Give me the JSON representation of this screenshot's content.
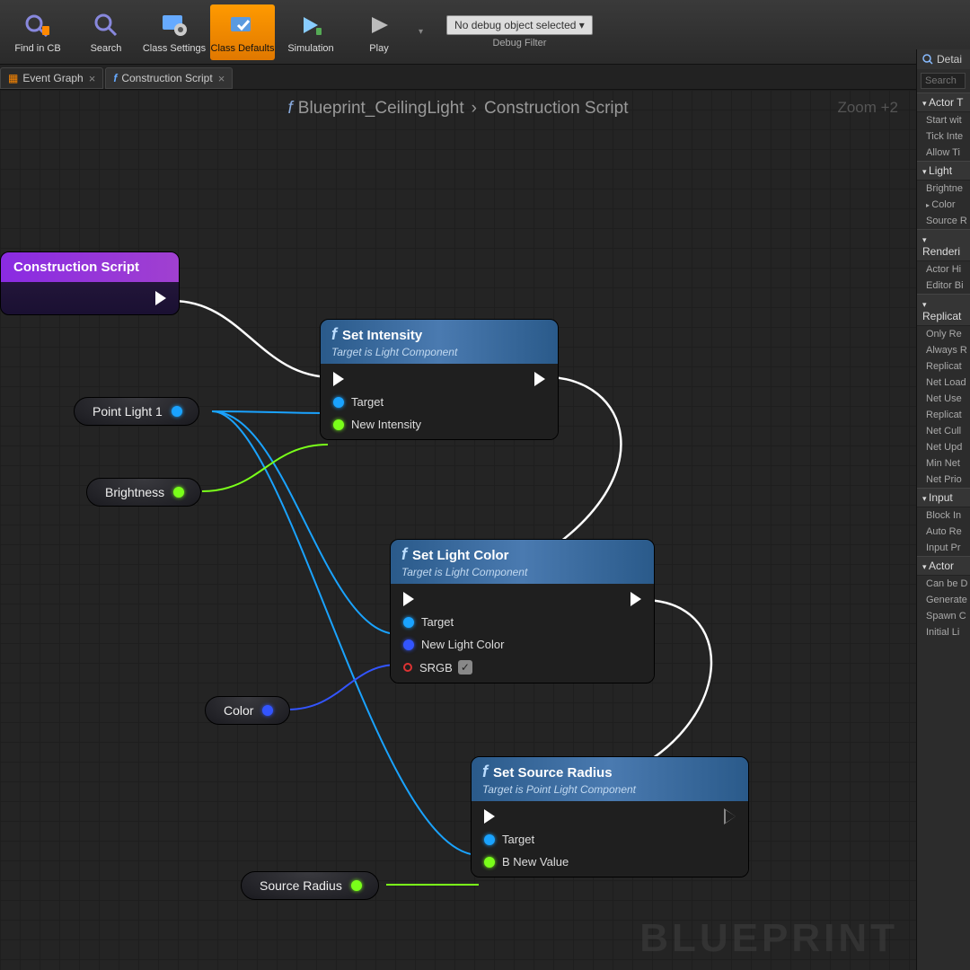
{
  "toolbar": {
    "find_cb": "Find in CB",
    "search": "Search",
    "class_settings": "Class Settings",
    "class_defaults": "Class Defaults",
    "simulation": "Simulation",
    "play": "Play",
    "debug_select": "No debug object selected ▾",
    "debug_filter": "Debug Filter"
  },
  "tabs": {
    "event_graph": "Event Graph",
    "construction_script": "Construction Script"
  },
  "breadcrumb": {
    "blueprint": "Blueprint_CeilingLight",
    "page": "Construction Script"
  },
  "zoom": "Zoom +2",
  "watermark": "BLUEPRINT",
  "nodes": {
    "entry": "Construction Script",
    "set_intensity": {
      "title": "Set Intensity",
      "sub": "Target is Light Component",
      "pin_target": "Target",
      "pin_intensity": "New Intensity"
    },
    "set_light_color": {
      "title": "Set Light Color",
      "sub": "Target is Light Component",
      "pin_target": "Target",
      "pin_color": "New Light Color",
      "pin_srgb": "SRGB"
    },
    "set_source_radius": {
      "title": "Set Source Radius",
      "sub": "Target is Point Light Component",
      "pin_target": "Target",
      "pin_value": "B New Value"
    }
  },
  "pills": {
    "point_light": "Point Light 1",
    "brightness": "Brightness",
    "color": "Color",
    "source_radius": "Source Radius"
  },
  "details": {
    "header": "Detai",
    "search_placeholder": "Search",
    "sections": {
      "actor_tick": {
        "label": "Actor T",
        "items": [
          "Start wit",
          "Tick Inte",
          "Allow Ti"
        ]
      },
      "light": {
        "label": "Light",
        "items": [
          "Brightne",
          "Color",
          "Source R"
        ]
      },
      "rendering": {
        "label": "Renderi",
        "items": [
          "Actor Hi",
          "Editor Bi"
        ]
      },
      "replication": {
        "label": "Replicat",
        "items": [
          "Only Re",
          "Always R",
          "Replicat",
          "Net Load",
          "Net Use",
          "Replicat",
          "Net Cull",
          "Net Upd",
          "Min Net",
          "Net Prio"
        ]
      },
      "input": {
        "label": "Input",
        "items": [
          "Block In",
          "Auto Re",
          "Input Pr"
        ]
      },
      "actor": {
        "label": "Actor",
        "items": [
          "Can be D",
          "Generate",
          "Spawn C",
          "Initial Li"
        ]
      }
    }
  }
}
